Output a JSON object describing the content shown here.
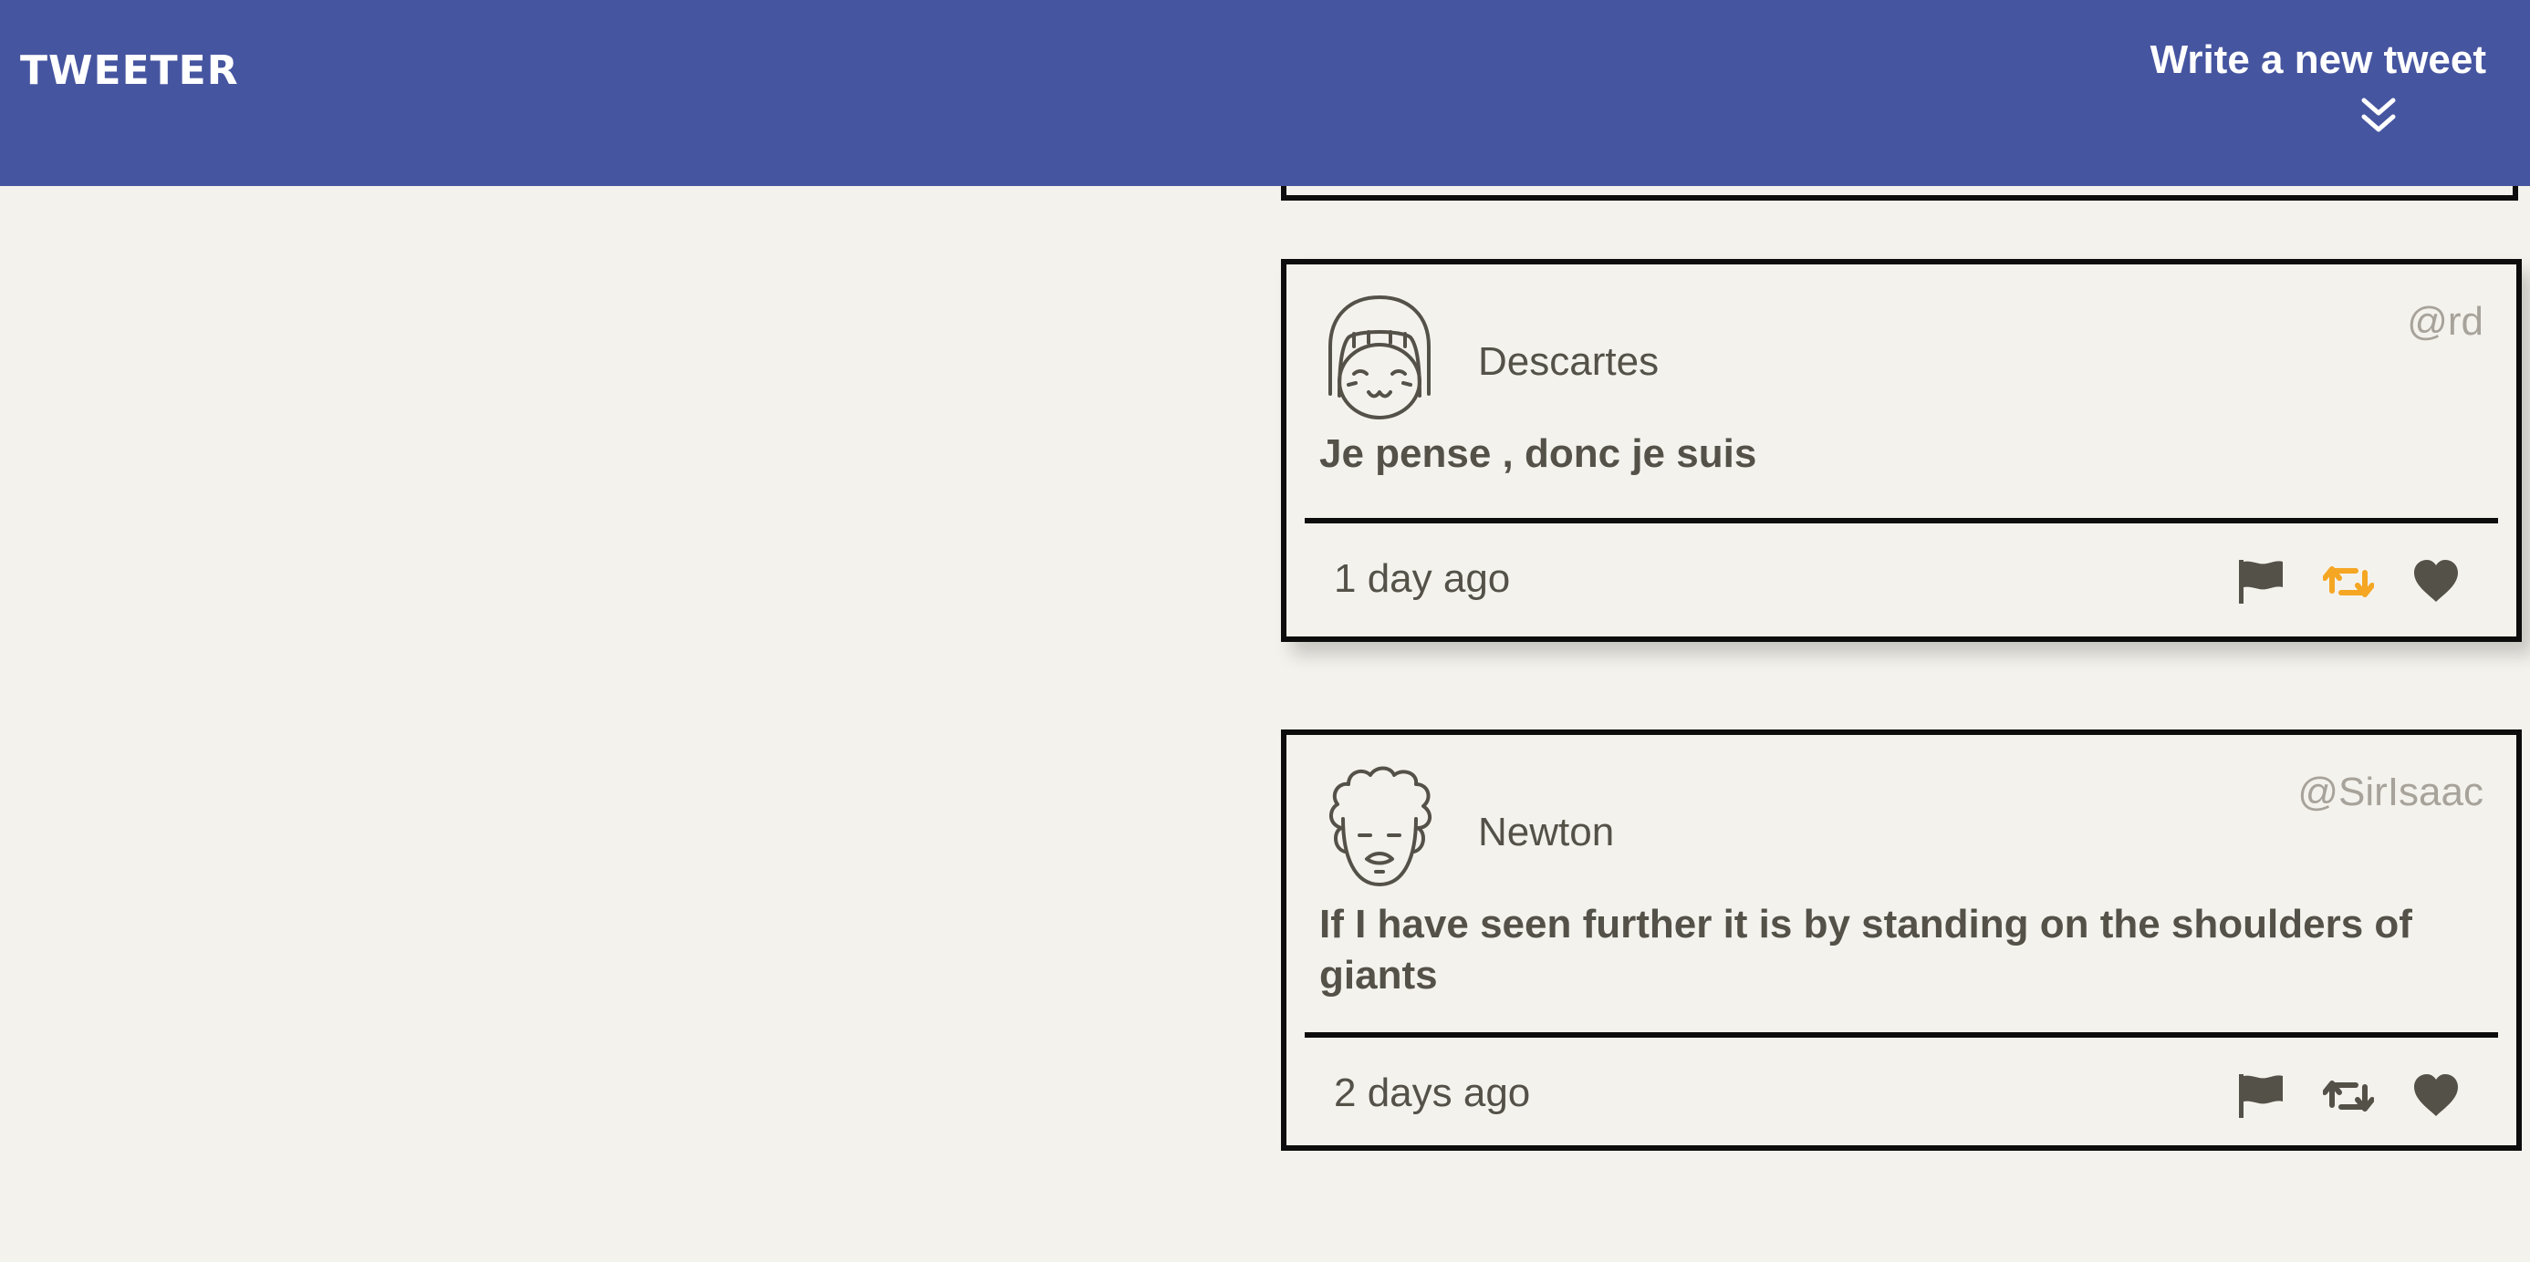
{
  "nav": {
    "logo": "TWEETER",
    "compose_label": "Write a new tweet",
    "compose_icon": "double-chevron-down-icon"
  },
  "colors": {
    "nav_bg": "#4655a0",
    "page_bg": "#f4f2ec",
    "text": "#545149",
    "handle": "#a7a39b",
    "retweet_active": "#f5a623"
  },
  "tweets": [
    {
      "avatar": "girl-face-avatar-icon",
      "name": "Descartes",
      "handle": "@rd",
      "content": "Je pense , donc je suis",
      "time": "1 day ago",
      "actions": [
        "flag-icon",
        "retweet-icon",
        "heart-icon"
      ],
      "retweet_active": true
    },
    {
      "avatar": "curly-hair-face-avatar-icon",
      "name": "Newton",
      "handle": "@SirIsaac",
      "content": "If I have seen further it is by standing on the shoulders of giants",
      "time": "2 days ago",
      "actions": [
        "flag-icon",
        "retweet-icon",
        "heart-icon"
      ],
      "retweet_active": false
    }
  ]
}
